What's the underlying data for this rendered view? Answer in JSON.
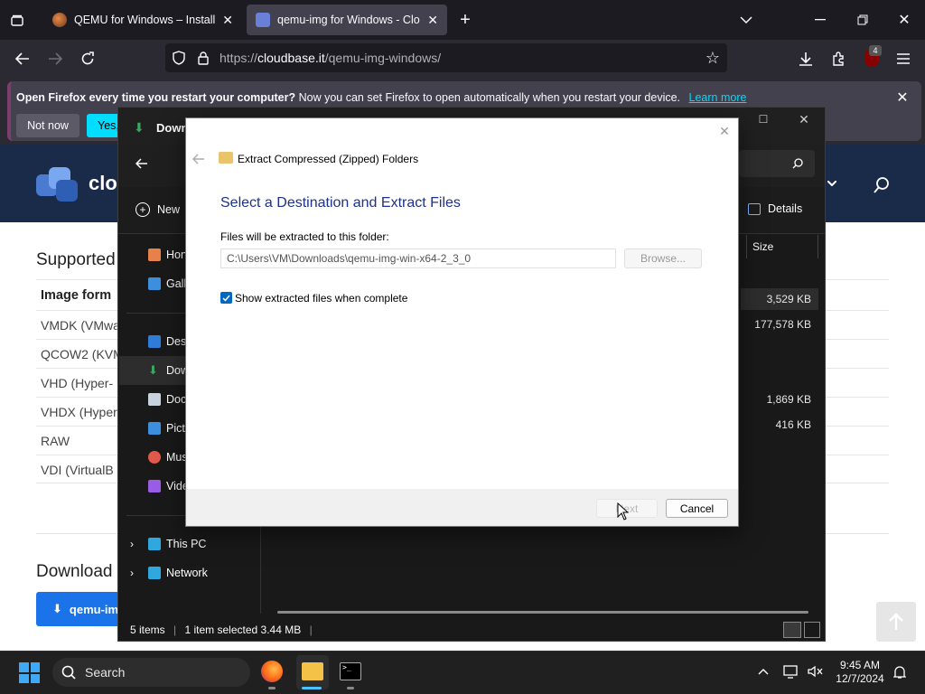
{
  "browser": {
    "tabs": [
      {
        "title": "QEMU for Windows – Installers",
        "active": false
      },
      {
        "title": "qemu-img for Windows - Cloud",
        "active": true
      }
    ],
    "url": {
      "scheme": "https://",
      "domain": "cloudbase.it",
      "path": "/qemu-img-windows/"
    },
    "extension_badge": "4",
    "notification": {
      "bold": "Open Firefox every time you restart your computer?",
      "text": " Now you can set Firefox to open automatically when you restart your device.",
      "link": "Learn more",
      "btn_not_now": "Not now",
      "btn_yes": "Yes,"
    }
  },
  "webpage": {
    "logo_text": "clo",
    "section_title": "Supported",
    "table_header": "Image form",
    "rows": [
      "VMDK (VMwa",
      "QCOW2 (KVM",
      "VHD (Hyper-",
      "VHDX (Hyper",
      "RAW",
      "VDI (VirtualB"
    ],
    "downloads_title": "Download",
    "download_btn": "qemu-im"
  },
  "explorer": {
    "title": "Down",
    "toolbar_new": "New",
    "details": "Details",
    "col_size": "Size",
    "sidebar": [
      "Hon",
      "Gall",
      "Desk",
      "Dow",
      "Doc",
      "Pict",
      "Mus",
      "Vide"
    ],
    "this_pc": "This PC",
    "network": "Network",
    "sizes": [
      "3,529 KB",
      "177,578 KB",
      "1,869 KB",
      "416 KB"
    ],
    "status_items": "5 items",
    "status_selected": "1 item selected  3.44 MB"
  },
  "dialog": {
    "title": "Extract Compressed (Zipped) Folders",
    "heading": "Select a Destination and Extract Files",
    "label": "Files will be extracted to this folder:",
    "path": "C:\\Users\\VM\\Downloads\\qemu-img-win-x64-2_3_0",
    "browse": "Browse...",
    "checkbox": "Show extracted files when complete",
    "checked": true,
    "next": "Next",
    "cancel": "Cancel"
  },
  "taskbar": {
    "search": "Search",
    "time": "9:45 AM",
    "date": "12/7/2024"
  },
  "colors": {
    "accent": "#0078d4",
    "firefox_blue": "#00ddff",
    "bg_dark": "#1c1b22"
  }
}
